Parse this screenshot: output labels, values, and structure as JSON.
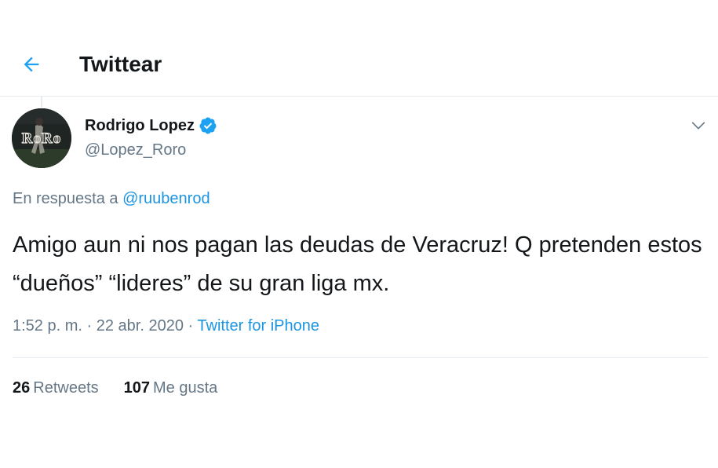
{
  "header": {
    "back_icon": "arrow-left-icon",
    "title": "Twittear"
  },
  "tweet": {
    "author": {
      "name": "Rodrigo Lopez",
      "handle": "@Lopez_Roro",
      "verified": true,
      "verified_icon": "verified-badge-icon",
      "avatar_text": "RoRo"
    },
    "more_icon": "chevron-down-icon",
    "reply_to": {
      "prefix": "En respuesta a",
      "handle": "@ruubenrod"
    },
    "text": "Amigo aun ni nos pagan las deudas de Veracruz! Q pretenden estos “dueños”  “lideres” de su gran liga mx.",
    "time": "1:52 p. m.",
    "separator": "·",
    "date": "22 abr. 2020",
    "source": "Twitter for iPhone",
    "stats": {
      "retweets_count": "26",
      "retweets_label": "Retweets",
      "likes_count": "107",
      "likes_label": "Me gusta"
    }
  },
  "colors": {
    "accent": "#1da1f2",
    "link": "#1b95e0",
    "text": "#14171a",
    "secondary_text": "#657786",
    "divider": "#e6ecf0"
  }
}
